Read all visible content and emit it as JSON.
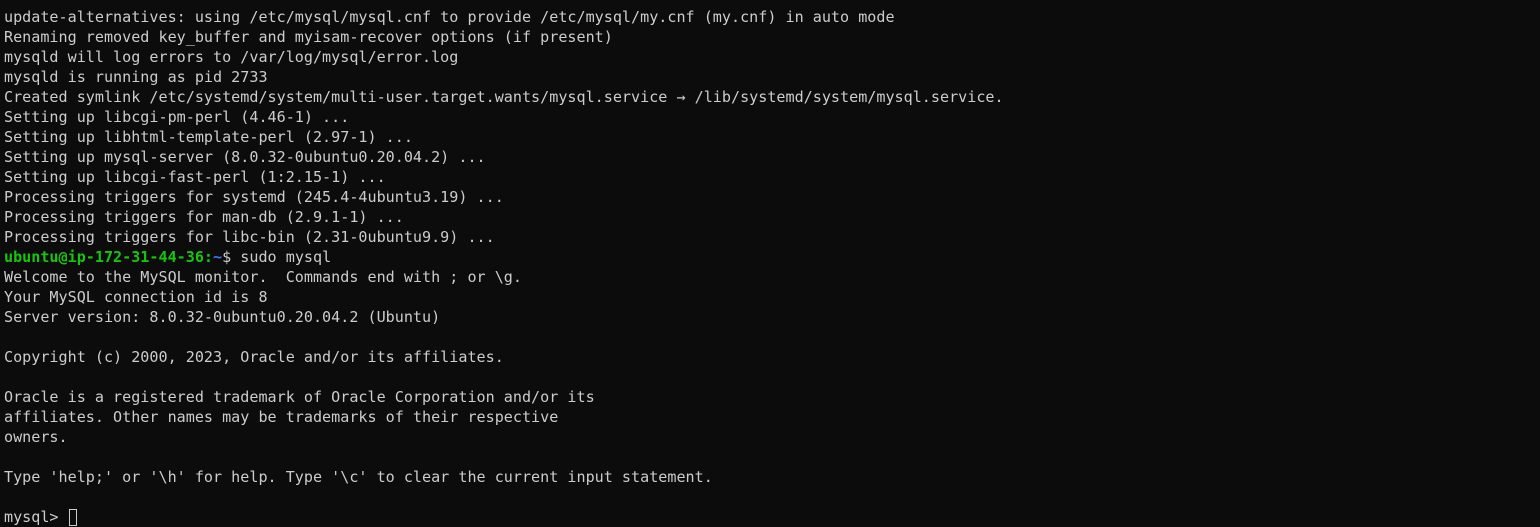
{
  "colors": {
    "background": "#0c0c0c",
    "foreground": "#cccccc",
    "prompt_user": "#16c60c",
    "prompt_path": "#3b78ff"
  },
  "lines": [
    "update-alternatives: using /etc/mysql/mysql.cnf to provide /etc/mysql/my.cnf (my.cnf) in auto mode",
    "Renaming removed key_buffer and myisam-recover options (if present)",
    "mysqld will log errors to /var/log/mysql/error.log",
    "mysqld is running as pid 2733",
    "Created symlink /etc/systemd/system/multi-user.target.wants/mysql.service → /lib/systemd/system/mysql.service.",
    "Setting up libcgi-pm-perl (4.46-1) ...",
    "Setting up libhtml-template-perl (2.97-1) ...",
    "Setting up mysql-server (8.0.32-0ubuntu0.20.04.2) ...",
    "Setting up libcgi-fast-perl (1:2.15-1) ...",
    "Processing triggers for systemd (245.4-4ubuntu3.19) ...",
    "Processing triggers for man-db (2.9.1-1) ...",
    "Processing triggers for libc-bin (2.31-0ubuntu9.9) ..."
  ],
  "shell_prompt": {
    "user_host": "ubuntu@ip-172-31-44-36",
    "separator": ":",
    "path": "~",
    "symbol": "$ ",
    "command": "sudo mysql"
  },
  "mysql_output": [
    "Welcome to the MySQL monitor.  Commands end with ; or \\g.",
    "Your MySQL connection id is 8",
    "Server version: 8.0.32-0ubuntu0.20.04.2 (Ubuntu)",
    "",
    "Copyright (c) 2000, 2023, Oracle and/or its affiliates.",
    "",
    "Oracle is a registered trademark of Oracle Corporation and/or its",
    "affiliates. Other names may be trademarks of their respective",
    "owners.",
    "",
    "Type 'help;' or '\\h' for help. Type '\\c' to clear the current input statement.",
    ""
  ],
  "mysql_prompt": "mysql> "
}
